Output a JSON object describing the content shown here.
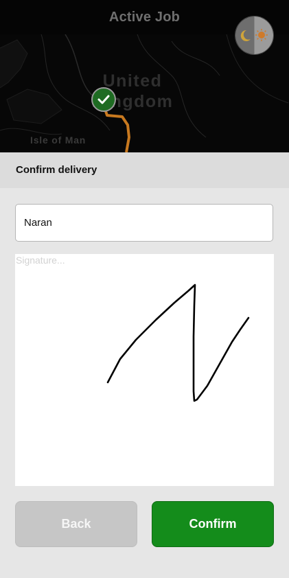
{
  "header": {
    "title": "Active Job"
  },
  "map": {
    "region_label": "United Kingdom",
    "island_label": "Isle of Man",
    "marker_icon": "check-circle-icon",
    "route_color": "#c8791f",
    "theme_toggle_icons": [
      "moon-icon",
      "sun-icon"
    ]
  },
  "panel": {
    "title": "Confirm delivery"
  },
  "form": {
    "name_value": "Naran",
    "signature_placeholder": "Signature..."
  },
  "actions": {
    "back_label": "Back",
    "confirm_label": "Confirm"
  },
  "colors": {
    "confirm": "#148c1b",
    "back": "#c6c6c6",
    "background": "#e6e6e6"
  }
}
